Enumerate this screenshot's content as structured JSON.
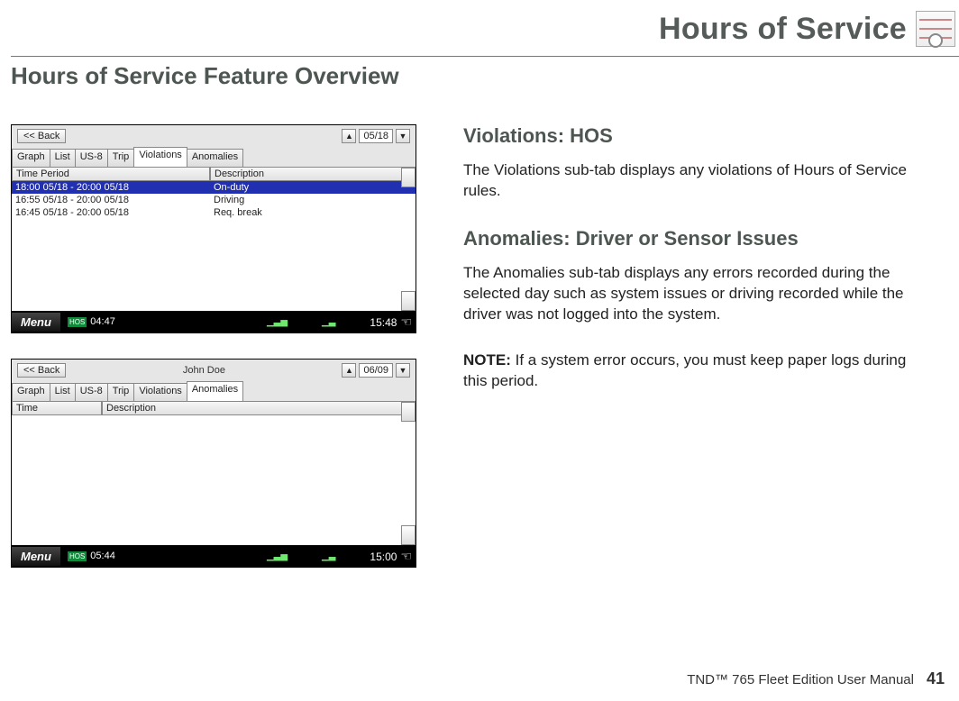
{
  "header": {
    "chapter_title": "Hours of Service"
  },
  "section_title": "Hours of Service Feature Overview",
  "right": {
    "h_violations": "Violations: HOS",
    "p_violations": "The Violations sub-tab displays any violations of Hours of Service rules.",
    "h_anomalies": "Anomalies: Driver or Sensor Issues",
    "p_anomalies": "The Anomalies sub-tab displays any errors recorded during the selected day such as system issues or driving recorded while the driver was not logged into the system.",
    "note_label": "NOTE:",
    "note_body": " If a system error occurs, you must keep paper logs during this period."
  },
  "ss1": {
    "back": "<< Back",
    "date": "05/18",
    "tabs": [
      "Graph",
      "List",
      "US-8",
      "Trip",
      "Violations",
      "Anomalies"
    ],
    "active_tab": "Violations",
    "col_time": "Time Period",
    "col_desc": "Description",
    "rows": [
      {
        "time": "18:00 05/18 - 20:00 05/18",
        "desc": "On-duty",
        "selected": true
      },
      {
        "time": "16:55 05/18 - 20:00 05/18",
        "desc": "Driving",
        "selected": false
      },
      {
        "time": "16:45 05/18 - 20:00 05/18",
        "desc": "Req. break",
        "selected": false
      }
    ],
    "menu": "Menu",
    "hos": "HOS",
    "hos_time": "04:47",
    "clock": "15:48"
  },
  "ss2": {
    "back": "<< Back",
    "driver": "John Doe",
    "date": "06/09",
    "tabs": [
      "Graph",
      "List",
      "US-8",
      "Trip",
      "Violations",
      "Anomalies"
    ],
    "active_tab": "Anomalies",
    "col_time": "Time",
    "col_desc": "Description",
    "menu": "Menu",
    "hos": "HOS",
    "hos_time": "05:44",
    "clock": "15:00"
  },
  "footer": {
    "manual": "TND™ 765 Fleet Edition User Manual",
    "page": "41"
  }
}
